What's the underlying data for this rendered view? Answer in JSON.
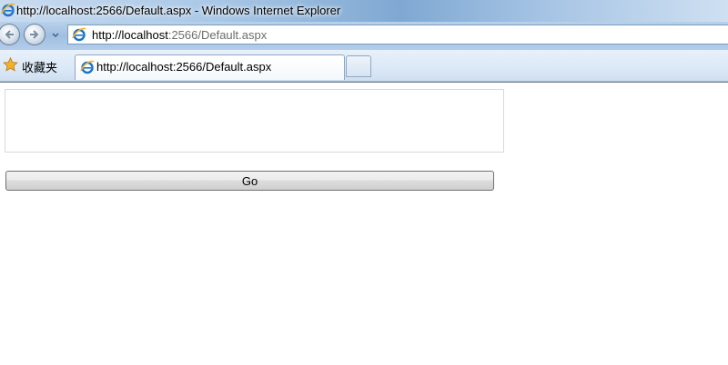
{
  "window": {
    "title": "http://localhost:2566/Default.aspx - Windows Internet Explorer"
  },
  "address_bar": {
    "url_host": "http://localhost",
    "url_path": ":2566/Default.aspx"
  },
  "favorites_bar": {
    "favorites_label": "收藏夹"
  },
  "tabs": [
    {
      "label": "http://localhost:2566/Default.aspx",
      "active": true
    }
  ],
  "page": {
    "textarea_value": "",
    "go_button_label": "Go"
  },
  "icons": {
    "browser": "ie-icon",
    "favorites": "star-icon",
    "back": "back-arrow-icon",
    "forward": "forward-arrow-icon",
    "dropdown": "chevron-down-icon"
  },
  "colors": {
    "title_bar": "#a9c7e6",
    "favorites_star": "#f2b227",
    "ie_logo": "#1d73c9"
  }
}
